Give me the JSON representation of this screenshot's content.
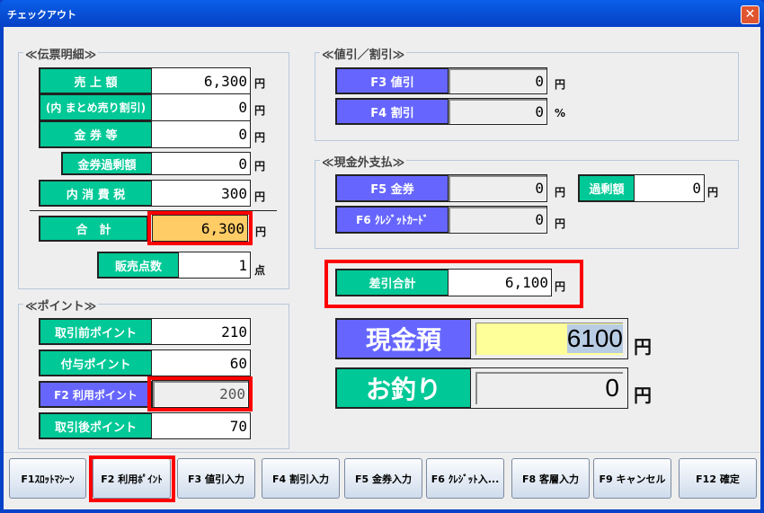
{
  "window": {
    "title": "チェックアウト",
    "close": "✕"
  },
  "slip": {
    "title": "≪伝票明細≫",
    "rows": [
      {
        "label": "売 上 額",
        "value": "6,300",
        "unit": "円"
      },
      {
        "label": "(内 まとめ売り割引)",
        "value": "0",
        "unit": "円"
      },
      {
        "label": "金 券 等",
        "value": "0",
        "unit": "円"
      },
      {
        "label": "金券過剰額",
        "value": "0",
        "unit": "円"
      },
      {
        "label": "内 消 費 税",
        "value": "300",
        "unit": "円"
      }
    ],
    "total": {
      "label": "合　計",
      "value": "6,300",
      "unit": "円"
    },
    "count": {
      "label": "販売点数",
      "value": "1",
      "unit": "点"
    }
  },
  "points": {
    "title": "≪ポイント≫",
    "rows": [
      {
        "label": "取引前ポイント",
        "value": "210"
      },
      {
        "label": "付与ポイント",
        "value": "60"
      },
      {
        "label": "F2 利用ポイント",
        "value": "200"
      },
      {
        "label": "取引後ポイント",
        "value": "70"
      }
    ]
  },
  "discount": {
    "title": "≪値引／割引≫",
    "rows": [
      {
        "label": "F3 値引",
        "value": "0",
        "unit": "円"
      },
      {
        "label": "F4 割引",
        "value": "0",
        "unit": "%"
      }
    ]
  },
  "noncash": {
    "title": "≪現金外支払≫",
    "rows": [
      {
        "label": "F5 金券",
        "value": "0",
        "unit": "円"
      },
      {
        "label": "F6 ｸﾚｼﾞｯﾄｶｰﾄﾞ",
        "value": "0",
        "unit": "円"
      }
    ],
    "excess": {
      "label": "過剰額",
      "value": "0",
      "unit": "円"
    }
  },
  "net": {
    "label": "差引合計",
    "value": "6,100",
    "unit": "円"
  },
  "cash": {
    "label": "現金預",
    "value": "6100",
    "unit": "円"
  },
  "change": {
    "label": "お釣り",
    "value": "0",
    "unit": "円"
  },
  "buttons": [
    "F1ｽﾛｯﾄﾏｼｰﾝ",
    "F2 利用ﾎﾟｲﾝﾄ",
    "F3 値引入力",
    "F4 割引入力",
    "F5 金券入力",
    "F6 ｸﾚｼﾞｯﾄ入...",
    "F8 客層入力",
    "F9 キャンセル",
    "F12 確定"
  ],
  "colors": {
    "green": "#00c896",
    "blue": "#6666ff",
    "highlight": "#ffcc66",
    "cash_input": "#ffff99"
  }
}
